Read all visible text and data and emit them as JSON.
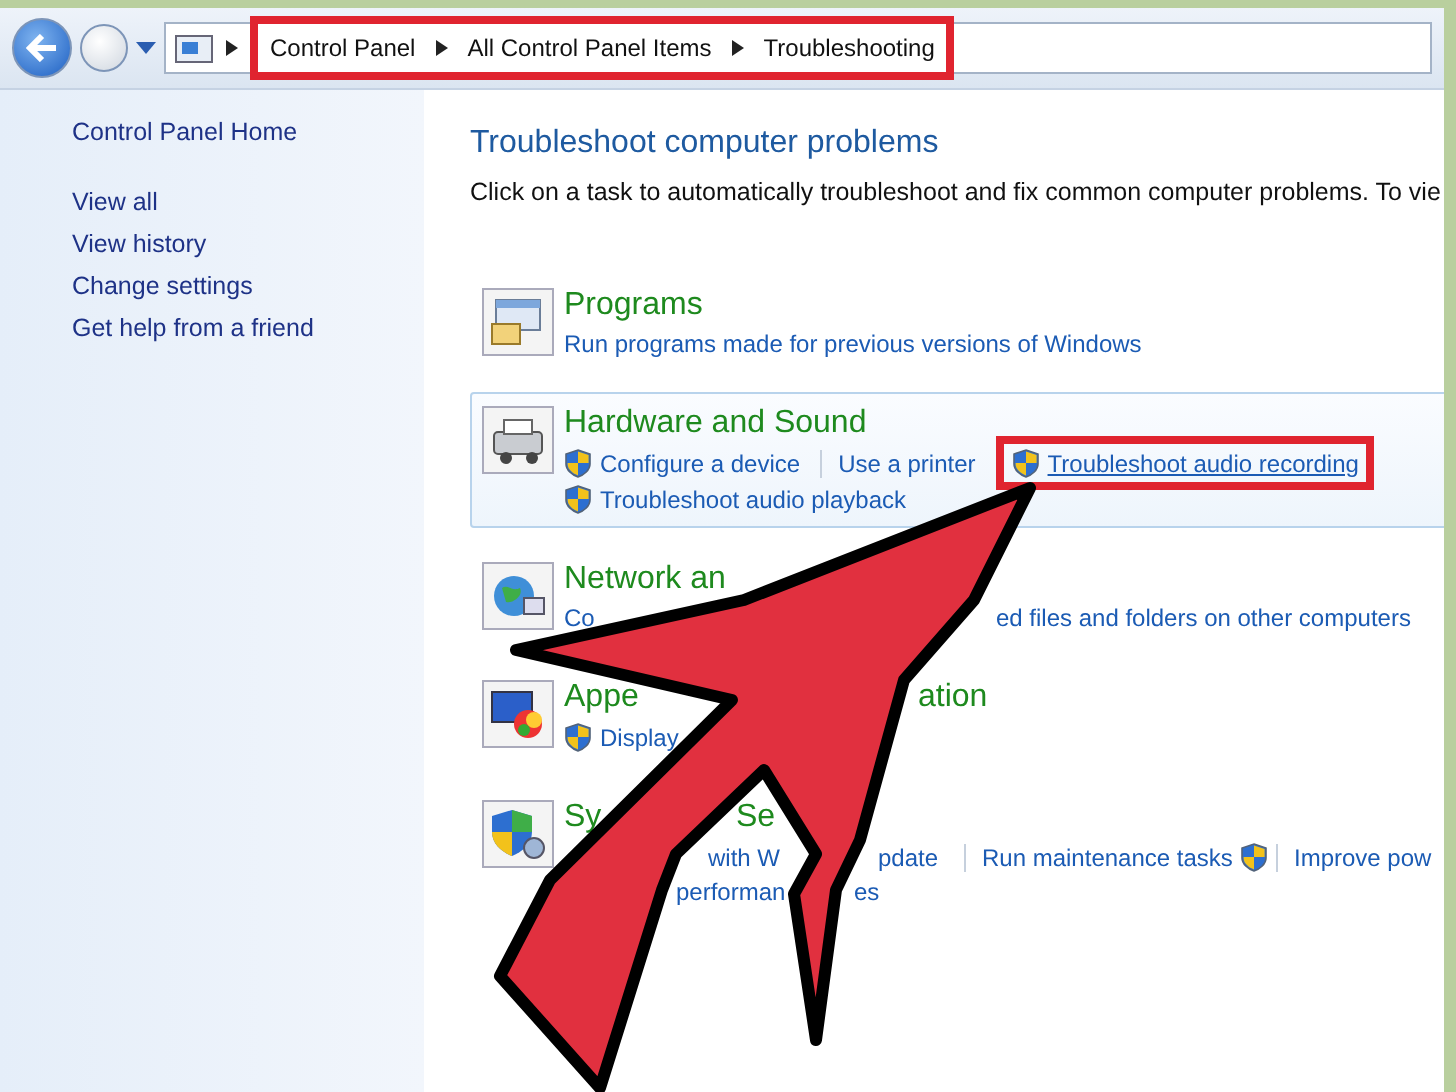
{
  "navigation": {
    "breadcrumb": [
      {
        "text": "Control Panel"
      },
      {
        "text": "All Control Panel Items"
      },
      {
        "text": "Troubleshooting"
      }
    ],
    "highlighted": true
  },
  "sidebar": {
    "items": [
      {
        "text": "Control Panel Home"
      },
      {
        "text": "View all"
      },
      {
        "text": "View history"
      },
      {
        "text": "Change settings"
      },
      {
        "text": "Get help from a friend"
      }
    ]
  },
  "main": {
    "title": "Troubleshoot computer problems",
    "subtitle": "Click on a task to automatically troubleshoot and fix common computer problems. To vie"
  },
  "categories": [
    {
      "title_parts": [
        "Programs"
      ],
      "selected": false,
      "rows": [
        [
          {
            "text": "Run programs made for previous versions of Windows",
            "shield": false,
            "separator_before": false,
            "highlighted": false
          }
        ]
      ]
    },
    {
      "title_parts": [
        "Hardware and Sound"
      ],
      "selected": true,
      "rows": [
        [
          {
            "text": "Configure a device",
            "shield": true,
            "separator_before": false,
            "highlighted": false
          },
          {
            "text": "Use a printer",
            "shield": false,
            "separator_before": true,
            "highlighted": false
          },
          {
            "text": "Troubleshoot audio recording",
            "shield": true,
            "separator_before": false,
            "highlighted": true
          }
        ],
        [
          {
            "text": "Troubleshoot audio playback",
            "shield": true,
            "separator_before": false,
            "highlighted": false
          }
        ]
      ]
    },
    {
      "title_parts": [
        "Network an"
      ],
      "selected": false,
      "rows": [
        [
          {
            "text": "Co",
            "shield": false,
            "separator_before": false,
            "highlighted": false
          },
          {
            "text": "ed files and folders on other computers",
            "shield": false,
            "separator_before": false,
            "highlighted": false
          }
        ]
      ]
    },
    {
      "title_parts": [
        "Appe",
        "ation"
      ],
      "selected": false,
      "rows": [
        [
          {
            "text": "Display",
            "shield": true,
            "separator_before": false,
            "highlighted": false
          }
        ]
      ]
    },
    {
      "title_parts": [
        "Sy",
        "Se"
      ],
      "selected": false,
      "rows": [
        [
          {
            "text": "with W",
            "shield": false,
            "separator_before": false,
            "highlighted": false
          },
          {
            "text": "pdate",
            "shield": false,
            "separator_before": false,
            "highlighted": false
          },
          {
            "text": "Run maintenance tasks",
            "shield": false,
            "separator_before": true,
            "highlighted": false
          },
          {
            "text": "Improve pow",
            "shield": true,
            "separator_before": true,
            "highlighted": false
          }
        ],
        [
          {
            "text": "performan",
            "shield": false,
            "separator_before": false,
            "highlighted": false
          },
          {
            "text": "es",
            "shield": false,
            "separator_before": false,
            "highlighted": false
          }
        ]
      ]
    }
  ]
}
